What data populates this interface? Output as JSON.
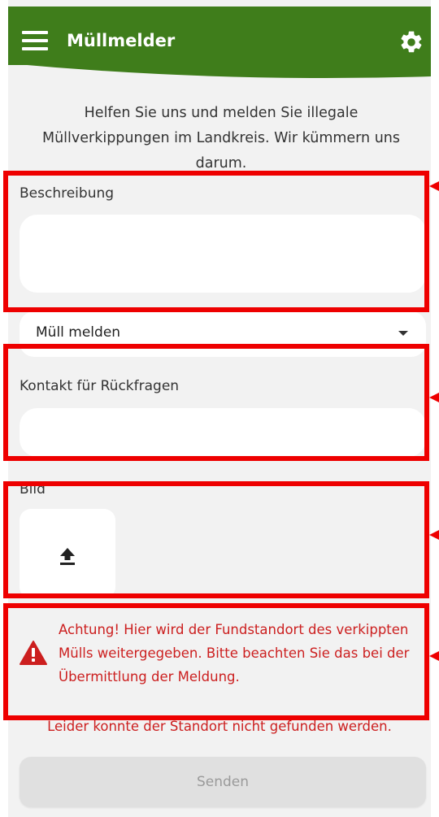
{
  "app": {
    "title": "Müllmelder",
    "accent": "#3f7d1b"
  },
  "intro": {
    "text": "Helfen Sie uns und melden Sie illegale Müllverkippungen im Landkreis. Wir kümmern uns darum."
  },
  "form": {
    "description_label": "Beschreibung",
    "description_value": "",
    "category_value": "Müll melden",
    "contact_label": "Kontakt für Rückfragen",
    "contact_value": "",
    "image_label": "Bild"
  },
  "warning": {
    "text": "Achtung! Hier wird der Fundstandort des verkippten Mülls weitergegeben. Bitte beachten Sie das bei der Übermittlung der Meldung.",
    "color": "#cc1f1f"
  },
  "error": {
    "text": "Leider konnte der Standort nicht gefunden werden."
  },
  "actions": {
    "send_label": "Senden"
  },
  "icons": [
    "menu-icon",
    "gear-icon",
    "upload-icon",
    "warning-icon",
    "dropdown-caret-icon"
  ],
  "highlight_color": "#ee0000"
}
